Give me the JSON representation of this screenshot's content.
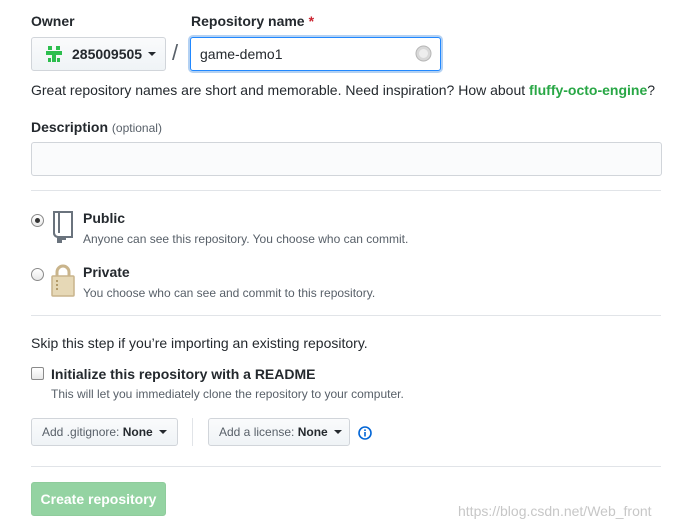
{
  "owner": {
    "label": "Owner",
    "value": "285009505",
    "avatar_color": "#2cbe4e"
  },
  "separator": "/",
  "repo_name": {
    "label": "Repository name",
    "required_mark": "*",
    "value": "game-demo1"
  },
  "suggestion": {
    "prefix": "Great repository names are short and memorable. Need inspiration? How about ",
    "name": "fluffy-octo-engine",
    "suffix": "?",
    "name_color": "#28a745"
  },
  "description": {
    "label": "Description",
    "optional": "(optional)",
    "value": ""
  },
  "visibility": {
    "public": {
      "title": "Public",
      "note": "Anyone can see this repository. You choose who can commit.",
      "checked": true
    },
    "private": {
      "title": "Private",
      "note": "You choose who can see and commit to this repository.",
      "checked": false
    }
  },
  "init": {
    "skip_text": "Skip this step if you’re importing an existing repository.",
    "readme_label": "Initialize this repository with a README",
    "readme_note": "This will let you immediately clone the repository to your computer.",
    "readme_checked": false
  },
  "gitignore": {
    "prefix": "Add .gitignore:",
    "value": "None"
  },
  "license": {
    "prefix": "Add a license:",
    "value": "None"
  },
  "create_button": {
    "label": "Create repository",
    "color": "#94d3a2"
  },
  "watermark": "https://blog.csdn.net/Web_front"
}
